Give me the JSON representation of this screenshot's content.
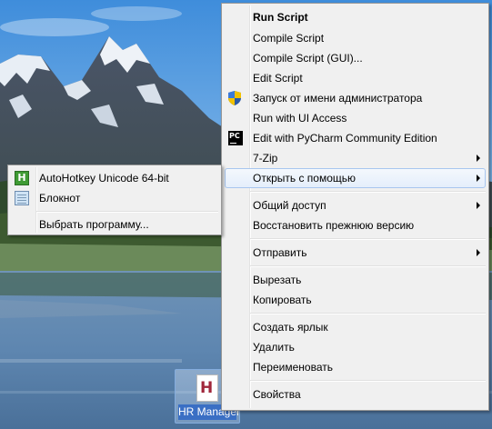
{
  "desktop": {
    "icon_label": "HR Manager",
    "icon_glyph": "H"
  },
  "context_menu": {
    "items": [
      {
        "label": "Run Script",
        "bold": true
      },
      {
        "label": "Compile Script"
      },
      {
        "label": "Compile Script (GUI)..."
      },
      {
        "label": "Edit Script"
      },
      {
        "label": "Запуск от имени администратора",
        "icon": "uac-shield-icon"
      },
      {
        "label": "Run with UI Access"
      },
      {
        "label": "Edit with PyCharm Community Edition",
        "icon": "pycharm-icon",
        "icon_text": "PC"
      },
      {
        "label": "7-Zip",
        "submenu": true
      },
      {
        "label": "Открыть с помощью",
        "submenu": true,
        "highlighted": true
      },
      {
        "label": "Общий доступ",
        "submenu": true
      },
      {
        "label": "Восстановить прежнюю версию"
      },
      {
        "label": "Отправить",
        "submenu": true
      },
      {
        "label": "Вырезать"
      },
      {
        "label": "Копировать"
      },
      {
        "label": "Создать ярлык"
      },
      {
        "label": "Удалить"
      },
      {
        "label": "Переименовать"
      },
      {
        "label": "Свойства"
      }
    ]
  },
  "open_with_submenu": {
    "items": [
      {
        "label": "AutoHotkey Unicode 64-bit",
        "icon": "autohotkey-icon",
        "icon_text": "H"
      },
      {
        "label": "Блокнот",
        "icon": "notepad-icon"
      },
      {
        "label": "Выбрать программу..."
      }
    ]
  },
  "colors": {
    "menu_background": "#f0f0f0",
    "highlight_border": "#a8c6ef",
    "selection_label": "#3a6fc4"
  }
}
